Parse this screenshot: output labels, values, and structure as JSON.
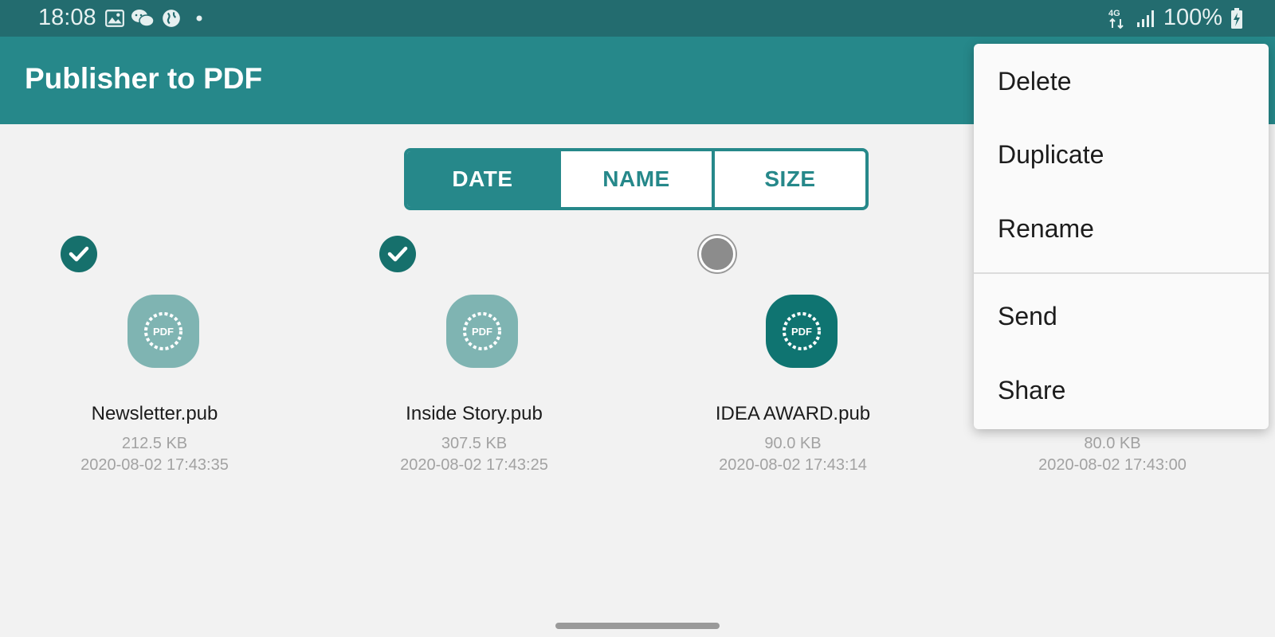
{
  "status_bar": {
    "time": "18:08",
    "left_icons": [
      "image-icon",
      "wechat-icon",
      "globe-icon",
      "dot-icon"
    ],
    "network": "4G",
    "battery": "100%"
  },
  "app_bar": {
    "title": "Publisher to PDF"
  },
  "sort_tabs": [
    {
      "label": "DATE",
      "active": true
    },
    {
      "label": "NAME",
      "active": false
    },
    {
      "label": "SIZE",
      "active": false
    }
  ],
  "files": [
    {
      "name": "Newsletter.pub",
      "size": "212.5 KB",
      "date": "2020-08-02 17:43:35",
      "selected": true
    },
    {
      "name": "Inside Story.pub",
      "size": "307.5 KB",
      "date": "2020-08-02 17:43:25",
      "selected": true
    },
    {
      "name": "IDEA AWARD.pub",
      "size": "90.0 KB",
      "date": "2020-08-02 17:43:14",
      "selected": false
    },
    {
      "name": "",
      "size": "80.0 KB",
      "date": "2020-08-02 17:43:00",
      "selected": false
    }
  ],
  "file_icon_label": "PDF",
  "context_menu": {
    "items": [
      "Delete",
      "Duplicate",
      "Rename",
      "Send",
      "Share"
    ]
  },
  "colors": {
    "primary": "#26888a",
    "status_bar": "#236c6f",
    "check_on": "#16706c"
  }
}
